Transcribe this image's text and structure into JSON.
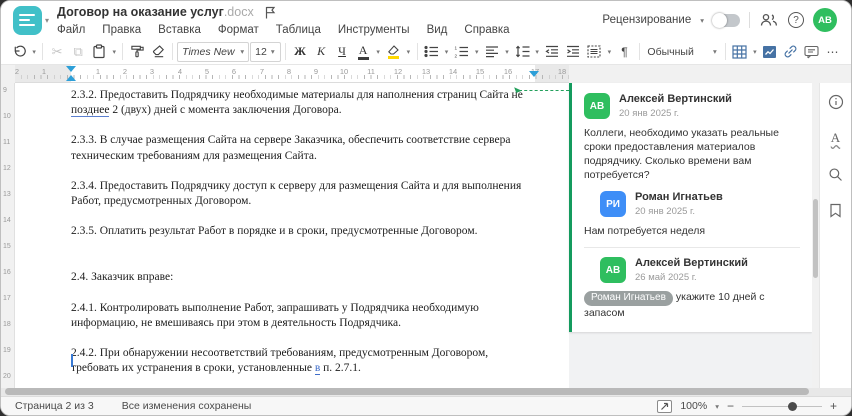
{
  "header": {
    "title": "Договор на оказание услуг",
    "title_ext": ".docx",
    "review_label": "Рецензирование",
    "avatar_initials": "АВ"
  },
  "menu": {
    "items": [
      "Файл",
      "Правка",
      "Вставка",
      "Формат",
      "Таблица",
      "Инструменты",
      "Вид",
      "Справка"
    ]
  },
  "toolbar": {
    "font_name": "Times New ...",
    "font_size": "12",
    "bold_label": "Ж",
    "italic_label": "К",
    "underline_label": "Ч",
    "font_color_label": "А",
    "style_name": "Обычный"
  },
  "icons": {
    "caret": "▾",
    "scissors": "✂",
    "copy": "⧉",
    "pilcrow": "¶",
    "more": "⋯",
    "question": "?",
    "spell_letter": "А",
    "minus": "−",
    "plus": "+"
  },
  "ruler": {
    "margin_numbers": [
      "2",
      "1"
    ],
    "numbers": [
      "1",
      "2",
      "3",
      "4",
      "5",
      "6",
      "7",
      "8",
      "9",
      "10",
      "11",
      "12",
      "13",
      "14",
      "15",
      "16",
      "17",
      "18"
    ],
    "v_numbers": [
      "9",
      "10",
      "11",
      "12",
      "13",
      "14",
      "15",
      "16",
      "17",
      "18",
      "19",
      "20"
    ]
  },
  "document": {
    "p1_pre": "2.3.2. Предоставить Подрядчику необходимые материалы для наполнения страниц Сайта не ",
    "p1_anchor": "позднее",
    "p1_post": " 2 (двух) дней с момента заключения Договора.",
    "p2": "2.3.3. В случае размещения Сайта на сервере Заказчика, обеспечить соответствие сервера техническим требованиям для размещения Сайта.",
    "p3": "2.3.4. Предоставить Подрядчику доступ к серверу для размещения Сайта и для выполнения Работ, предусмотренных Договором.",
    "p4": "2.3.5. Оплатить результат Работ в порядке и в сроки, предусмотренные Договором.",
    "p5": "2.4. Заказчик вправе:",
    "p6": "2.4.1. Контролировать выполнение Работ, запрашивать у Подрядчика необходимую информацию, не вмешиваясь при этом в деятельность Подрядчика.",
    "p7_pre": "2.4.2. При обнаружении несоответствий требованиям, предусмотренным Договором, требовать их устранения в сроки, установленные ",
    "p7_change": "в",
    "p7_post": " п. 2.7.1."
  },
  "comments": {
    "thread": [
      {
        "initials": "АВ",
        "name": "Алексей Вертинский",
        "date": "20 янв 2025 г.",
        "text": "Коллеги, необходимо указать реальные сроки предоставления материалов подрядчику. Сколько времени вам потребуется?"
      },
      {
        "initials": "РИ",
        "name": "Роман Игнатьев",
        "date": "20 янв 2025 г.",
        "text": "Нам потребуется неделя"
      },
      {
        "initials": "АВ",
        "name": "Алексей Вертинский",
        "date": "26 май 2025 г.",
        "mention": "Роман Игнатьев",
        "text": "укажите 10 дней с запасом"
      }
    ]
  },
  "status": {
    "page_label": "Страница 2 из 3",
    "saved_label": "Все изменения сохранены",
    "zoom_value": "100%"
  },
  "colors": {
    "brand_teal": "#41c0c8",
    "avatar_green": "#2fbe5f",
    "avatar_blue": "#3e8ef7",
    "comment_accent_green": "#149b5e",
    "ruler_marker_blue": "#2d9fd8",
    "insert_icon_blue": "#4672a4",
    "highlight_yellow": "#ffd800"
  }
}
